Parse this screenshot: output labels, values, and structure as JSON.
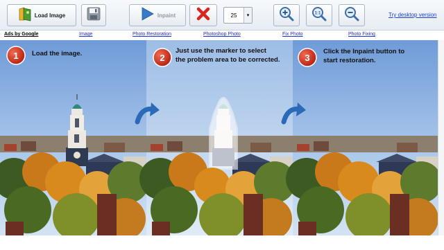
{
  "toolbar": {
    "load_image_label": "Load Image",
    "inpaint_label": "Inpaint",
    "zoom_value": "25",
    "desktop_link": "Try desktop version",
    "icons": {
      "load": "folder-image-icon",
      "save": "save-icon",
      "inpaint": "play-icon",
      "clear": "close-icon",
      "zoom_in": "zoom-in-icon",
      "zoom_reset": "zoom-1-1-icon",
      "zoom_out": "zoom-out-icon"
    }
  },
  "ads": {
    "title": "Ads by Google",
    "links": [
      "Image",
      "Photo Restoration",
      "Photoshop Photo",
      "Fix Photo",
      "Photo Fixing"
    ]
  },
  "steps": [
    {
      "number": "1",
      "line1": "Load the image.",
      "line2": ""
    },
    {
      "number": "2",
      "line1": "Just use the marker to select",
      "line2": "the problem area to be corrected."
    },
    {
      "number": "3",
      "line1": "Click the Inpaint button to",
      "line2": "start restoration."
    }
  ],
  "colors": {
    "step_badge": "#d9331f",
    "arrow": "#2b6ab8",
    "sky_top": "#6f9bd8",
    "sky_bottom": "#d3e3f3",
    "foliage_orange": "#d98a1c",
    "foliage_green": "#3c5a22",
    "link": "#1f2fd0"
  }
}
